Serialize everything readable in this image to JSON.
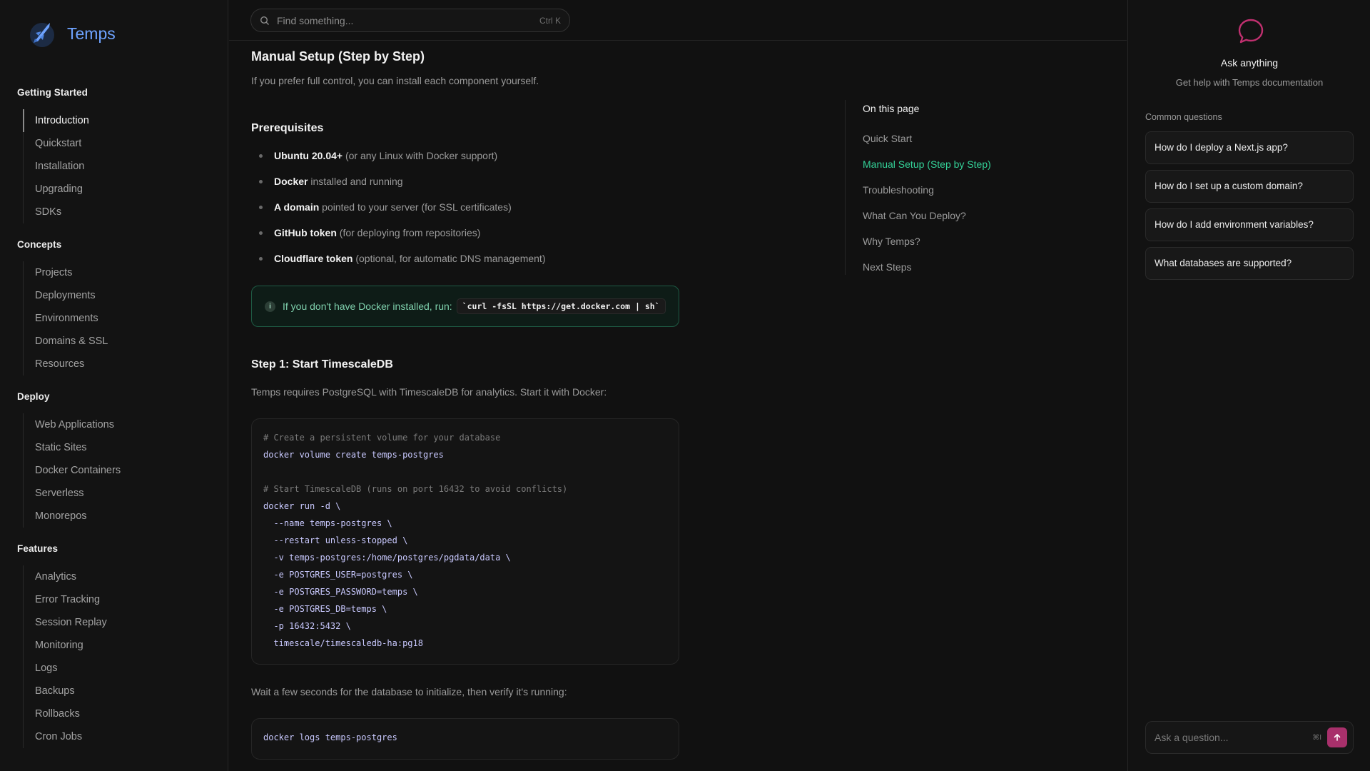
{
  "brand": {
    "name": "Temps"
  },
  "search": {
    "placeholder": "Find something...",
    "shortcut": "Ctrl K"
  },
  "sidebar": {
    "groups": [
      {
        "title": "Getting Started",
        "items": [
          "Introduction",
          "Quickstart",
          "Installation",
          "Upgrading",
          "SDKs"
        ]
      },
      {
        "title": "Concepts",
        "items": [
          "Projects",
          "Deployments",
          "Environments",
          "Domains & SSL",
          "Resources"
        ]
      },
      {
        "title": "Deploy",
        "items": [
          "Web Applications",
          "Static Sites",
          "Docker Containers",
          "Serverless",
          "Monorepos"
        ]
      },
      {
        "title": "Features",
        "items": [
          "Analytics",
          "Error Tracking",
          "Session Replay",
          "Monitoring",
          "Logs",
          "Backups",
          "Rollbacks",
          "Cron Jobs"
        ]
      }
    ],
    "active_item": "Introduction"
  },
  "main": {
    "section_title": "Manual Setup (Step by Step)",
    "section_intro": "If you prefer full control, you can install each component yourself.",
    "prereq_title": "Prerequisites",
    "prereqs": [
      {
        "bold": "Ubuntu 20.04+",
        "rest": " (or any Linux with Docker support)"
      },
      {
        "bold": "Docker",
        "rest": " installed and running"
      },
      {
        "bold": "A domain",
        "rest": " pointed to your server (for SSL certificates)"
      },
      {
        "bold": "GitHub token",
        "rest": " (for deploying from repositories)"
      },
      {
        "bold": "Cloudflare token",
        "rest": " (optional, for automatic DNS management)"
      }
    ],
    "callout": {
      "text": "If you don't have Docker installed, run:",
      "code": "`curl -fsSL https://get.docker.com | sh`"
    },
    "step1_title": "Step 1: Start TimescaleDB",
    "step1_intro": "Temps requires PostgreSQL with TimescaleDB for analytics. Start it with Docker:",
    "code1": [
      "# Create a persistent volume for your database",
      "docker volume create temps-postgres",
      "",
      "# Start TimescaleDB (runs on port 16432 to avoid conflicts)",
      "docker run -d \\",
      "  --name temps-postgres \\",
      "  --restart unless-stopped \\",
      "  -v temps-postgres:/home/postgres/pgdata/data \\",
      "  -e POSTGRES_USER=postgres \\",
      "  -e POSTGRES_PASSWORD=temps \\",
      "  -e POSTGRES_DB=temps \\",
      "  -p 16432:5432 \\",
      "  timescale/timescaledb-ha:pg18"
    ],
    "verify_text": "Wait a few seconds for the database to initialize, then verify it's running:",
    "code2": [
      "docker logs temps-postgres"
    ]
  },
  "toc": {
    "title": "On this page",
    "items": [
      "Quick Start",
      "Manual Setup (Step by Step)",
      "Troubleshooting",
      "What Can You Deploy?",
      "Why Temps?",
      "Next Steps"
    ],
    "active_item": "Manual Setup (Step by Step)"
  },
  "assistant": {
    "title": "Ask anything",
    "subtitle": "Get help with Temps documentation",
    "common_label": "Common questions",
    "questions": [
      "How do I deploy a Next.js app?",
      "How do I set up a custom domain?",
      "How do I add environment variables?",
      "What databases are supported?"
    ],
    "input_placeholder": "Ask a question...",
    "shortcut": "⌘I"
  },
  "colors": {
    "accent_green": "#34d399",
    "brand_blue": "#6ea3ff",
    "send_button": "#a8306b"
  }
}
